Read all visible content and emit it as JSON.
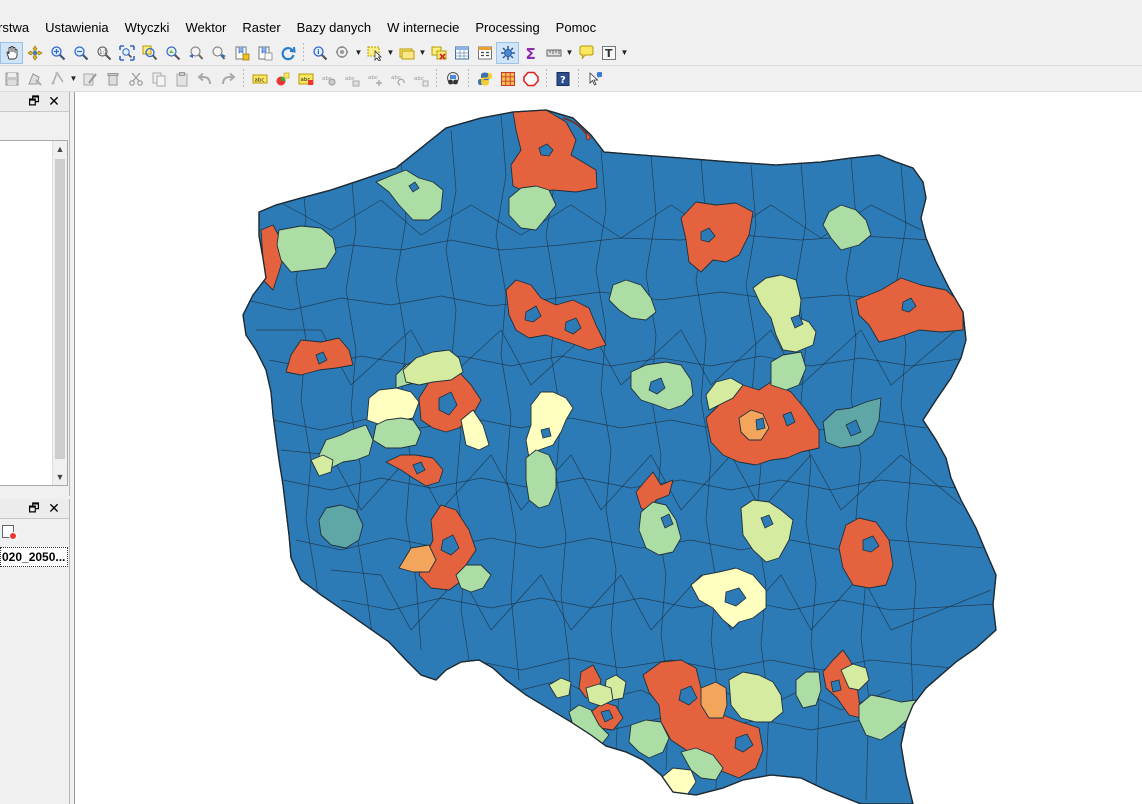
{
  "menubar": {
    "items": [
      "rstwa",
      "Ustawienia",
      "Wtyczki",
      "Wektor",
      "Raster",
      "Bazy danych",
      "W internecie",
      "Processing",
      "Pomoc"
    ]
  },
  "toolbar1": {
    "icons": [
      "pan-icon",
      "pan-to-selection-icon",
      "zoom-in-icon",
      "zoom-out-icon",
      "zoom-native-icon",
      "zoom-full-icon",
      "zoom-to-selection-icon",
      "zoom-to-layer-icon",
      "zoom-last-icon",
      "zoom-next-icon",
      "new-bookmark-icon",
      "show-bookmarks-icon",
      "refresh-icon",
      "identify-icon",
      "run-action-icon",
      "select-features-icon",
      "select-by-value-icon",
      "deselect-icon",
      "attribute-table-icon",
      "field-calculator-icon",
      "statistics-icon",
      "sum-icon",
      "measure-icon",
      "map-tips-icon",
      "text-annotation-icon"
    ]
  },
  "toolbar2": {
    "icons": [
      "save-edits-icon",
      "digitize-icon",
      "add-feature-icon",
      "vertex-tool-icon",
      "delete-selected-icon",
      "cut-features-icon",
      "copy-features-icon",
      "paste-features-icon",
      "undo-icon",
      "redo-icon",
      "label-tool-icon",
      "diagram-tool-icon",
      "highlight-label-icon",
      "pin-label-icon",
      "show-hide-labels-icon",
      "move-label-icon",
      "rotate-label-icon",
      "change-label-icon",
      "plugin-manager-icon",
      "python-console-icon",
      "grid-plugin-icon",
      "polygon-plugin-icon",
      "help-icon",
      "whats-this-icon"
    ]
  },
  "panels": {
    "layers": {
      "float_icon": "float-icon",
      "close_icon": "close-icon"
    },
    "browser": {
      "float_icon": "float-icon",
      "close_icon": "close-icon",
      "layer_label": "020_2050..."
    }
  },
  "map": {
    "colors": {
      "base": "#2c7bb6",
      "red": "#e4623e",
      "orange": "#f4a55c",
      "yellow": "#ffffbf",
      "lightgreen": "#abdda4",
      "palegreen": "#d4eba0",
      "teal": "#5fa6a6"
    }
  }
}
